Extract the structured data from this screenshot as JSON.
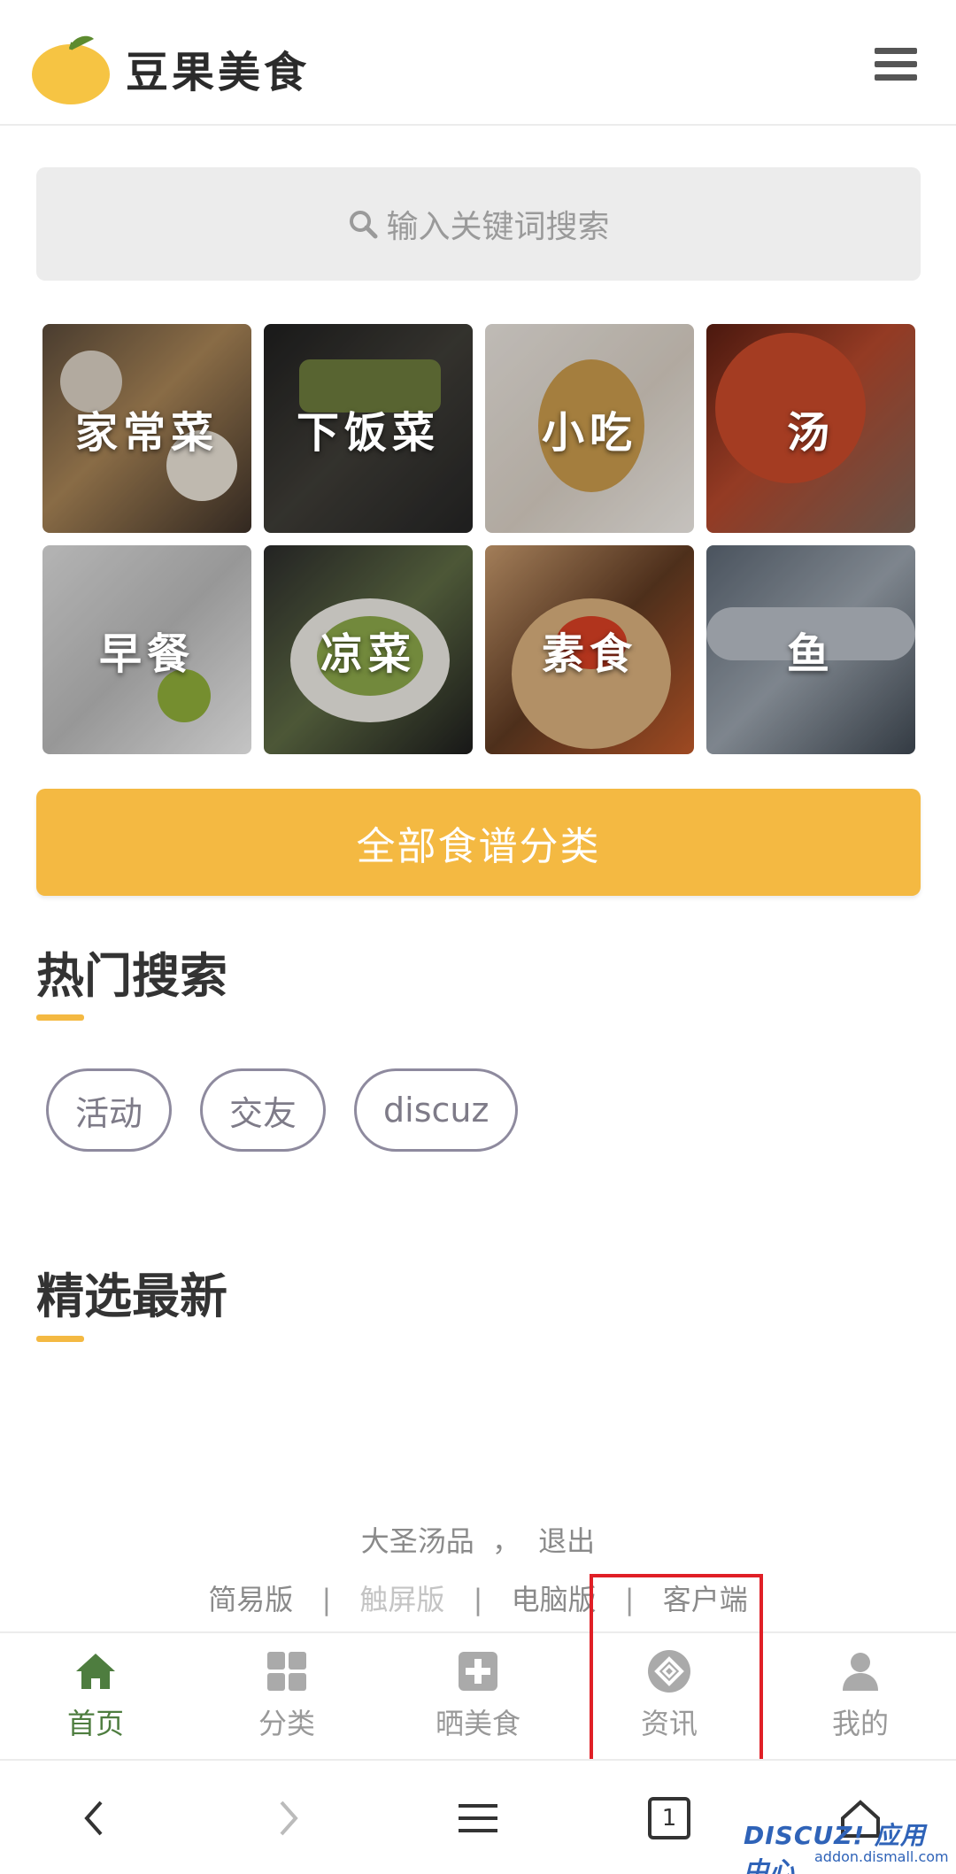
{
  "header": {
    "logo_text": "豆果美食",
    "menu_icon": "hamburger-menu-icon"
  },
  "search": {
    "placeholder": "输入关键词搜索",
    "icon": "search-icon"
  },
  "categories": [
    {
      "label": "家常菜"
    },
    {
      "label": "下饭菜"
    },
    {
      "label": "小吃"
    },
    {
      "label": "汤"
    },
    {
      "label": "早餐"
    },
    {
      "label": "凉菜"
    },
    {
      "label": "素食"
    },
    {
      "label": "鱼"
    }
  ],
  "all_recipes_button": "全部食谱分类",
  "hot_search": {
    "title": "热门搜索",
    "tags": [
      "活动",
      "交友",
      "discuz"
    ]
  },
  "latest": {
    "title": "精选最新"
  },
  "footer": {
    "username": "大圣汤品",
    "comma": "，",
    "logout": "退出",
    "links": [
      "简易版",
      "触屏版",
      "电脑版",
      "客户端"
    ],
    "separator": "|"
  },
  "tabbar": [
    {
      "label": "首页",
      "icon": "home-icon",
      "active": true
    },
    {
      "label": "分类",
      "icon": "grid-icon",
      "active": false
    },
    {
      "label": "晒美食",
      "icon": "plus-square-icon",
      "active": false
    },
    {
      "label": "资讯",
      "icon": "news-circle-icon",
      "active": false
    },
    {
      "label": "我的",
      "icon": "user-icon",
      "active": false
    }
  ],
  "browser_nav": {
    "tab_count": "1"
  },
  "watermark": {
    "main": "DISCUZ! 应用中心",
    "sub": "addon.dismall.com"
  },
  "colors": {
    "accent": "#f4b942",
    "active_tab": "#4e7d3f",
    "highlight": "#e01f26"
  }
}
